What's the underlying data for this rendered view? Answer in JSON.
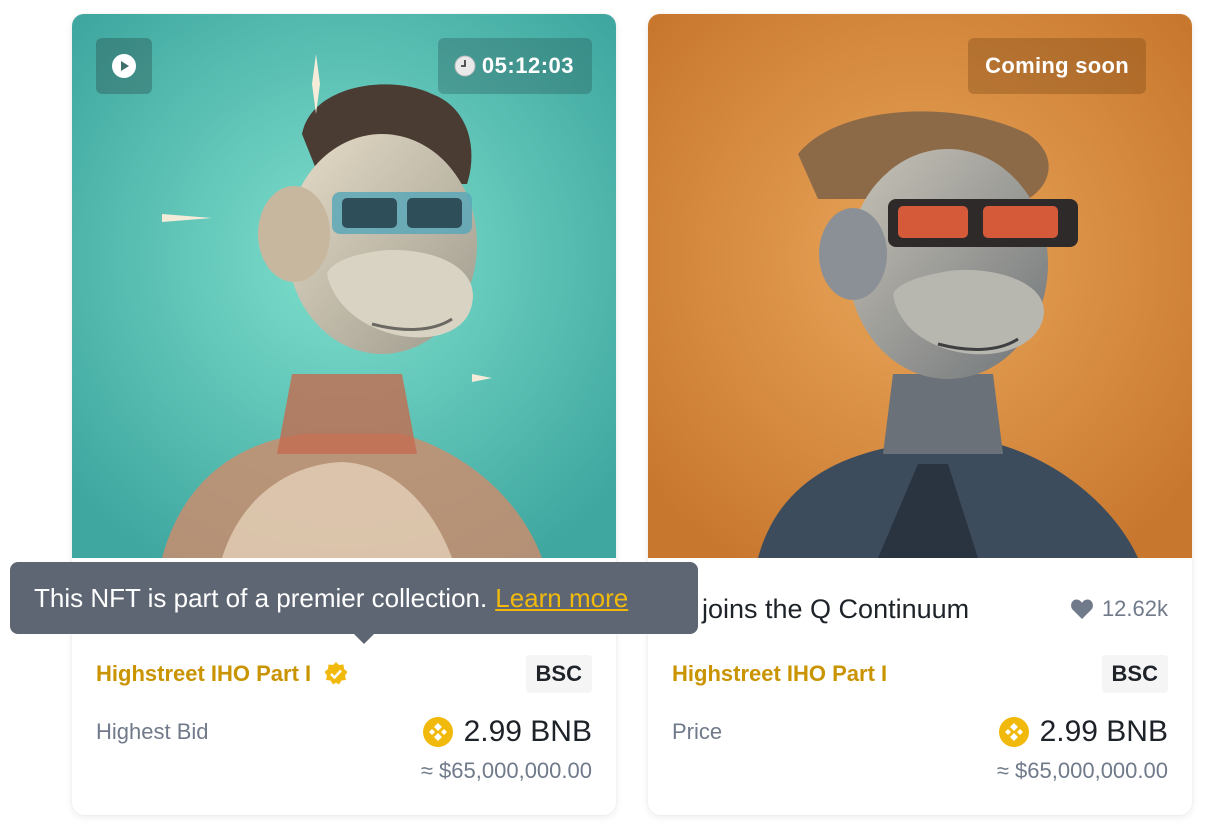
{
  "colors": {
    "accent_gold": "#C99400",
    "link_gold": "#F0B90B",
    "text_primary": "#1E2329",
    "text_secondary": "#707A8A",
    "tooltip_bg": "#5E6673",
    "art1_bg": "#4FB8AA",
    "art2_bg": "#D7913C"
  },
  "tooltip": {
    "text": "This NFT is part of a premier collection.",
    "link": "Learn more"
  },
  "cards": [
    {
      "timer": "05:12:03",
      "title": "",
      "collection": "Highstreet IHO Part I",
      "chain": "BSC",
      "price_label": "Highest Bid",
      "price": "2.99 BNB",
      "usd": "≈ $65,000,000.00",
      "icons": [
        "play-icon",
        "clock-icon",
        "verified-icon",
        "bnb-coin-icon"
      ]
    },
    {
      "status": "Coming soon",
      "title": "rk joins the Q Continuum",
      "likes": "12.62k",
      "collection": "Highstreet IHO Part I",
      "chain": "BSC",
      "price_label": "Price",
      "price": "2.99 BNB",
      "usd": "≈ $65,000,000.00",
      "icons": [
        "heart-icon",
        "bnb-coin-icon"
      ]
    }
  ]
}
